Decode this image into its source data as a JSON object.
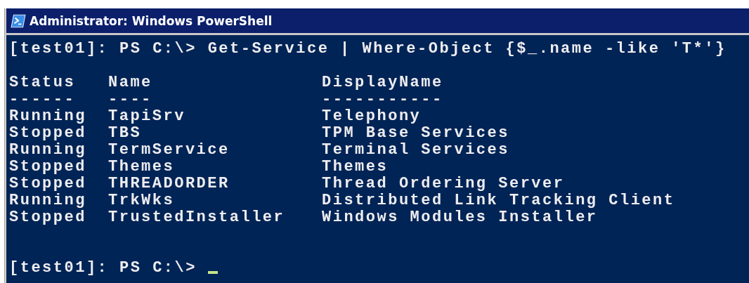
{
  "window": {
    "title": "Administrator: Windows PowerShell"
  },
  "console": {
    "command_line": "[test01]: PS C:\\> Get-Service | Where-Object {$_.name -like 'T*'}",
    "table": {
      "columns": [
        {
          "heading": "Status",
          "rule": "------"
        },
        {
          "heading": "Name",
          "rule": "----"
        },
        {
          "heading": "DisplayName",
          "rule": "-----------"
        }
      ],
      "rows": [
        [
          "Running",
          "TapiSrv",
          "Telephony"
        ],
        [
          "Stopped",
          "TBS",
          "TPM Base Services"
        ],
        [
          "Running",
          "TermService",
          "Terminal Services"
        ],
        [
          "Stopped",
          "Themes",
          "Themes"
        ],
        [
          "Stopped",
          "THREADORDER",
          "Thread Ordering Server"
        ],
        [
          "Running",
          "TrkWks",
          "Distributed Link Tracking Client"
        ],
        [
          "Stopped",
          "TrustedInstaller",
          "Windows Modules Installer"
        ]
      ]
    },
    "prompt": "[test01]: PS C:\\>"
  }
}
